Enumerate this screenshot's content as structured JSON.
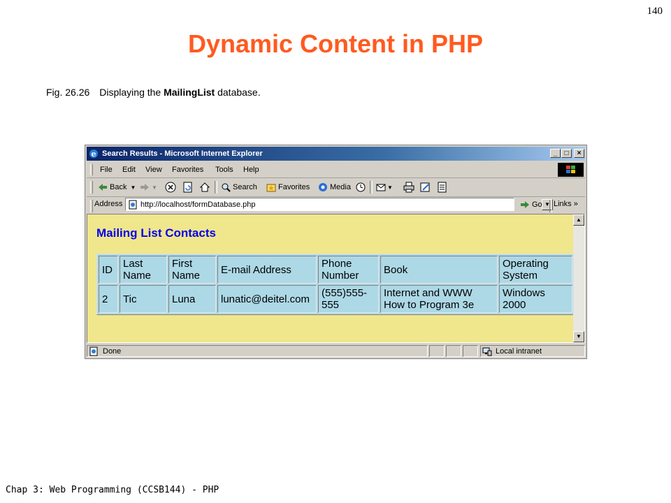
{
  "slide": {
    "number": "140",
    "title": "Dynamic Content in PHP",
    "caption": {
      "fig": "Fig. 26.26",
      "prefix": "Displaying the ",
      "emphasis": "MailingList",
      "suffix": " database."
    },
    "footer": "Chap 3: Web Programming (CCSB144) - PHP"
  },
  "browser": {
    "title": "Search Results - Microsoft Internet Explorer",
    "controls": {
      "minimize": "_",
      "maximize": "□",
      "close": "×"
    },
    "menu": [
      "File",
      "Edit",
      "View",
      "Favorites",
      "Tools",
      "Help"
    ],
    "toolbar": {
      "back": "Back",
      "search": "Search",
      "favorites": "Favorites",
      "media": "Media"
    },
    "address": {
      "label": "Address",
      "url": "http://localhost/formDatabase.php",
      "go": "Go",
      "links": "Links"
    },
    "status": {
      "text": "Done",
      "zone": "Local intranet"
    }
  },
  "page": {
    "heading": "Mailing List Contacts",
    "table": {
      "headers": {
        "id": "ID",
        "last": [
          "Last",
          "Name"
        ],
        "first": [
          "First",
          "Name"
        ],
        "email": "E-mail Address",
        "phone": [
          "Phone",
          "Number"
        ],
        "book": "Book",
        "os": [
          "Operating",
          "System"
        ]
      },
      "rows": [
        {
          "id": "2",
          "last": "Tic",
          "first": "Luna",
          "email": "lunatic@deitel.com",
          "phone": [
            "(555)555-",
            "555"
          ],
          "book": [
            "Internet and WWW",
            "How to Program 3e"
          ],
          "os": [
            "Windows",
            "2000"
          ]
        }
      ]
    }
  },
  "colors": {
    "title": "#ff5a1f",
    "page_background": "#f0e68c",
    "table_background": "#add8e6",
    "heading_text": "#0000ee"
  }
}
